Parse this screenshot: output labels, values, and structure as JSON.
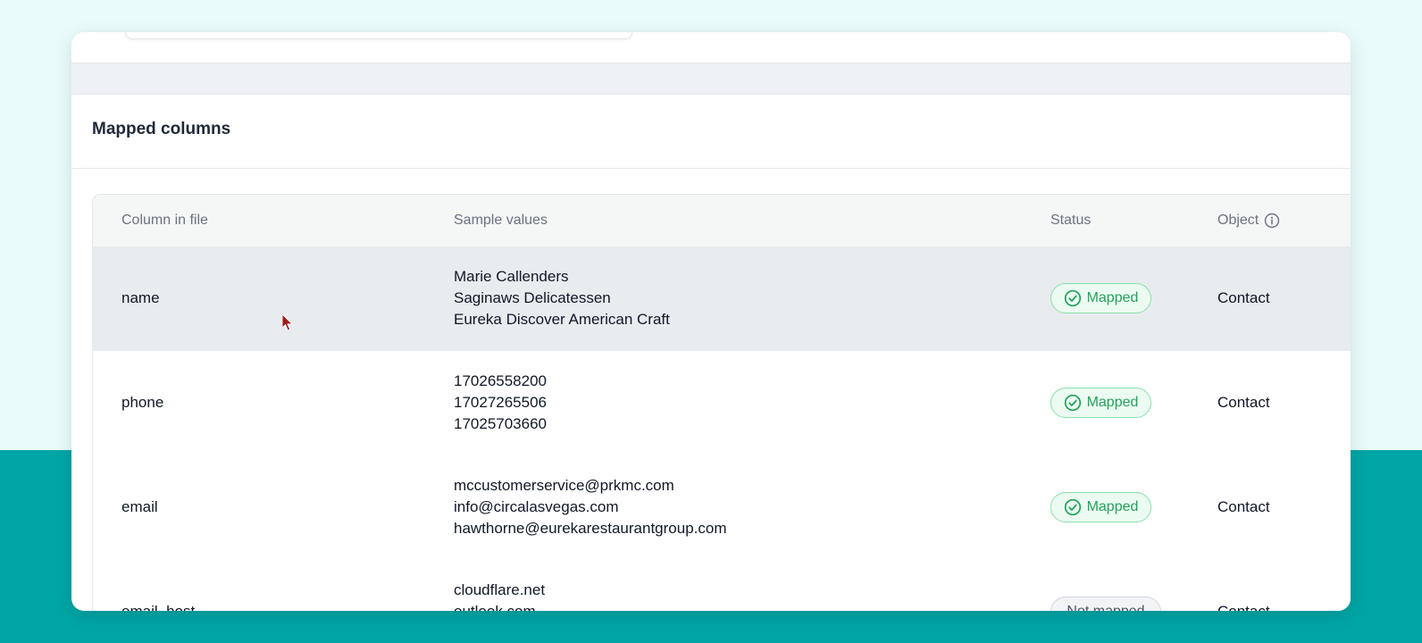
{
  "section": {
    "title": "Mapped columns"
  },
  "table": {
    "headers": {
      "column_in_file": "Column in file",
      "sample_values": "Sample values",
      "status": "Status",
      "object": "Object"
    },
    "rows": [
      {
        "column": "name",
        "samples": [
          "Marie Callenders",
          "Saginaws Delicatessen",
          "Eureka Discover American Craft"
        ],
        "status": "Mapped",
        "object": "Contact"
      },
      {
        "column": "phone",
        "samples": [
          "17026558200",
          "17027265506",
          "17025703660"
        ],
        "status": "Mapped",
        "object": "Contact"
      },
      {
        "column": "email",
        "samples": [
          "mccustomerservice@prkmc.com",
          "info@circalasvegas.com",
          "hawthorne@eurekarestaurantgroup.com"
        ],
        "status": "Mapped",
        "object": "Contact"
      },
      {
        "column": "email_host",
        "samples": [
          "cloudflare.net",
          "outlook.com"
        ],
        "status": "Not mapped",
        "object": "Contact"
      }
    ]
  },
  "icons": {
    "status_mapped": "check-circle-icon",
    "object_info": "info-icon"
  },
  "colors": {
    "mapped_green": "#22a35a",
    "teal_background": "#00a5a5"
  }
}
